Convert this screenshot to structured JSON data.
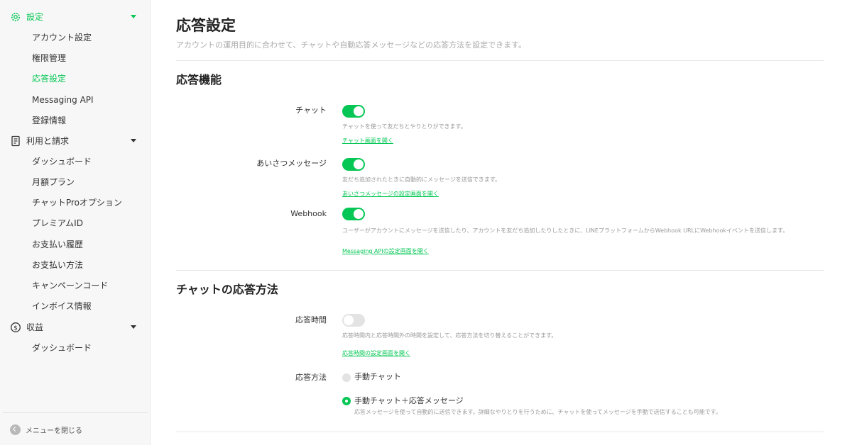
{
  "sidebar": {
    "groups": [
      {
        "label": "設定",
        "icon": "gear-icon"
      },
      {
        "label": "利用と請求",
        "icon": "billing-icon"
      },
      {
        "label": "収益",
        "icon": "dollar-icon"
      }
    ],
    "settings_items": [
      "アカウント設定",
      "権限管理",
      "応答設定",
      "Messaging API",
      "登録情報"
    ],
    "billing_items": [
      "ダッシュボード",
      "月額プラン",
      "チャットProオプション",
      "プレミアムID",
      "お支払い履歴",
      "お支払い方法",
      "キャンペーンコード",
      "インボイス情報"
    ],
    "revenue_items": [
      "ダッシュボード"
    ],
    "current_item": "応答設定",
    "close_label": "メニューを閉じる"
  },
  "page": {
    "title": "応答設定",
    "description": "アカウントの運用目的に合わせて、チャットや自動応答メッセージなどの応答方法を設定できます。"
  },
  "features": {
    "title": "応答機能",
    "chat": {
      "label": "チャット",
      "enabled": true,
      "help": "チャットを使って友だちとやりとりができます。",
      "link": "チャット画面を開く"
    },
    "greeting": {
      "label": "あいさつメッセージ",
      "enabled": true,
      "help": "友だち追加されたときに自動的にメッセージを送信できます。",
      "link": "あいさつメッセージの設定画面を開く"
    },
    "webhook": {
      "label": "Webhook",
      "enabled": true,
      "help": "ユーザーがアカウントにメッセージを送信したり、アカウントを友だち追加したりしたときに、LINEプラットフォームからWebhook URLにWebhookイベントを送信します。",
      "link": "Messaging APIの設定画面を開く"
    }
  },
  "chat_method": {
    "title": "チャットの応答方法",
    "hours": {
      "label": "応答時間",
      "enabled": false,
      "help": "応答時間内と応答時間外の時間を設定して、応答方法を切り替えることができます。",
      "link": "応答時間の設定画面を開く"
    },
    "method": {
      "label": "応答方法",
      "options": [
        {
          "label": "手動チャット",
          "selected": false
        },
        {
          "label": "手動チャット＋応答メッセージ",
          "selected": true,
          "help": "応答メッセージを使って自動的に送信できます。詳細なやりとりを行うために、チャットを使ってメッセージを手動で送信することも可能です。"
        }
      ]
    }
  },
  "colors": {
    "accent": "#06c755",
    "toggle_off": "#e3e3e3"
  }
}
